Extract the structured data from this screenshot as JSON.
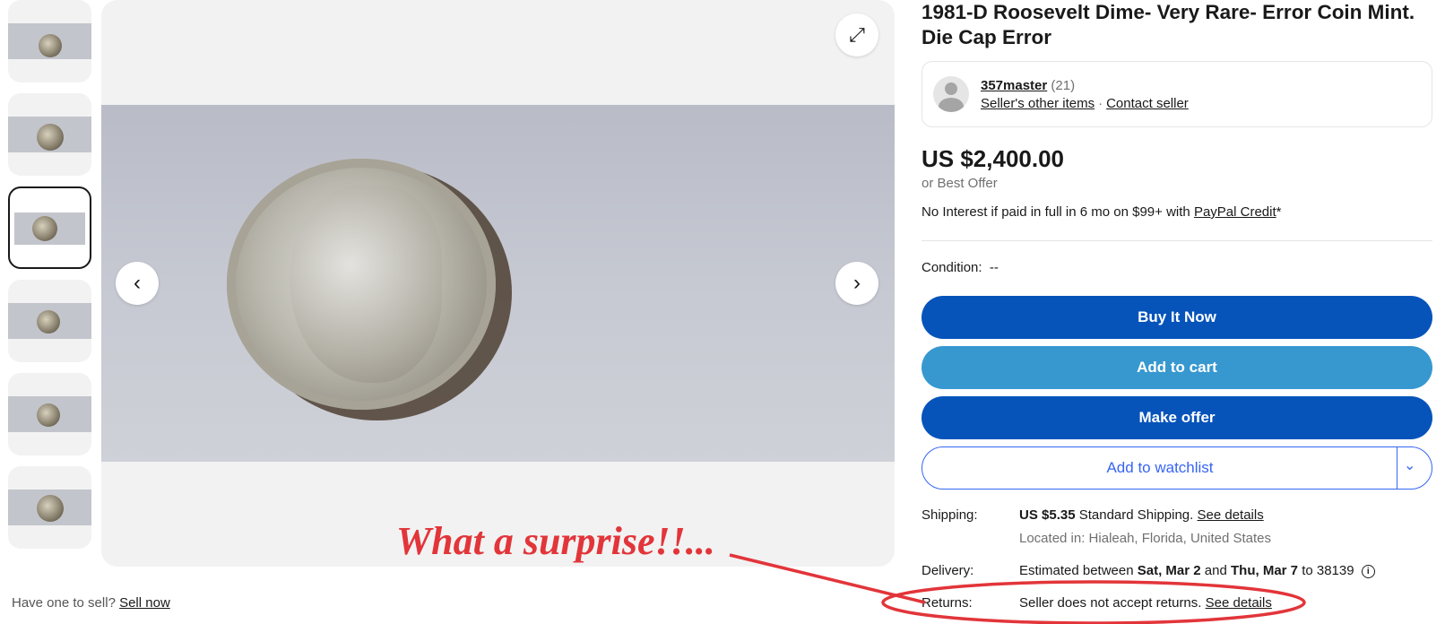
{
  "thumbnails": [
    {
      "label": "thumb-1",
      "selected": false
    },
    {
      "label": "thumb-2",
      "selected": false
    },
    {
      "label": "thumb-3",
      "selected": true
    },
    {
      "label": "thumb-4",
      "selected": false
    },
    {
      "label": "thumb-5",
      "selected": false
    },
    {
      "label": "thumb-6",
      "selected": false
    }
  ],
  "viewer": {
    "prev_icon": "‹",
    "next_icon": "›",
    "expand_icon": "⤢"
  },
  "sell": {
    "prompt": "Have one to sell?",
    "link": "Sell now"
  },
  "annotation": {
    "text": "What a surprise!!...",
    "color": "#e2353a"
  },
  "listing": {
    "title": "1981-D Roosevelt Dime- Very Rare- Error Coin Mint. Die Cap Error",
    "seller": {
      "name": "357master",
      "count": "(21)",
      "other_items": "Seller's other items",
      "dot": "·",
      "contact": "Contact seller"
    },
    "price": "US $2,400.00",
    "best_offer": "or Best Offer",
    "credit_text": "No Interest if paid in full in 6 mo on $99+ with",
    "credit_link": "PayPal Credit",
    "credit_suffix": "*",
    "condition_label": "Condition:",
    "condition_value": "--",
    "buttons": {
      "buy": "Buy It Now",
      "cart": "Add to cart",
      "offer": "Make offer",
      "watch": "Add to watchlist",
      "watch_chevron": "⌄"
    },
    "shipping": {
      "label": "Shipping:",
      "amount": "US $5.35",
      "text": "Standard Shipping.",
      "link": "See details",
      "location": "Located in: Hialeah, Florida, United States"
    },
    "delivery": {
      "label": "Delivery:",
      "prefix": "Estimated between",
      "start": "Sat, Mar 2",
      "and": "and",
      "end": "Thu, Mar 7",
      "to": "to 38139",
      "info_icon": "i"
    },
    "returns": {
      "label": "Returns:",
      "text": "Seller does not accept returns.",
      "link": "See details"
    }
  },
  "colors": {
    "primary_button": "#0654ba",
    "cart_button": "#3798d0",
    "watch_outline": "#3665f3",
    "annotation_red": "#e2353a"
  }
}
